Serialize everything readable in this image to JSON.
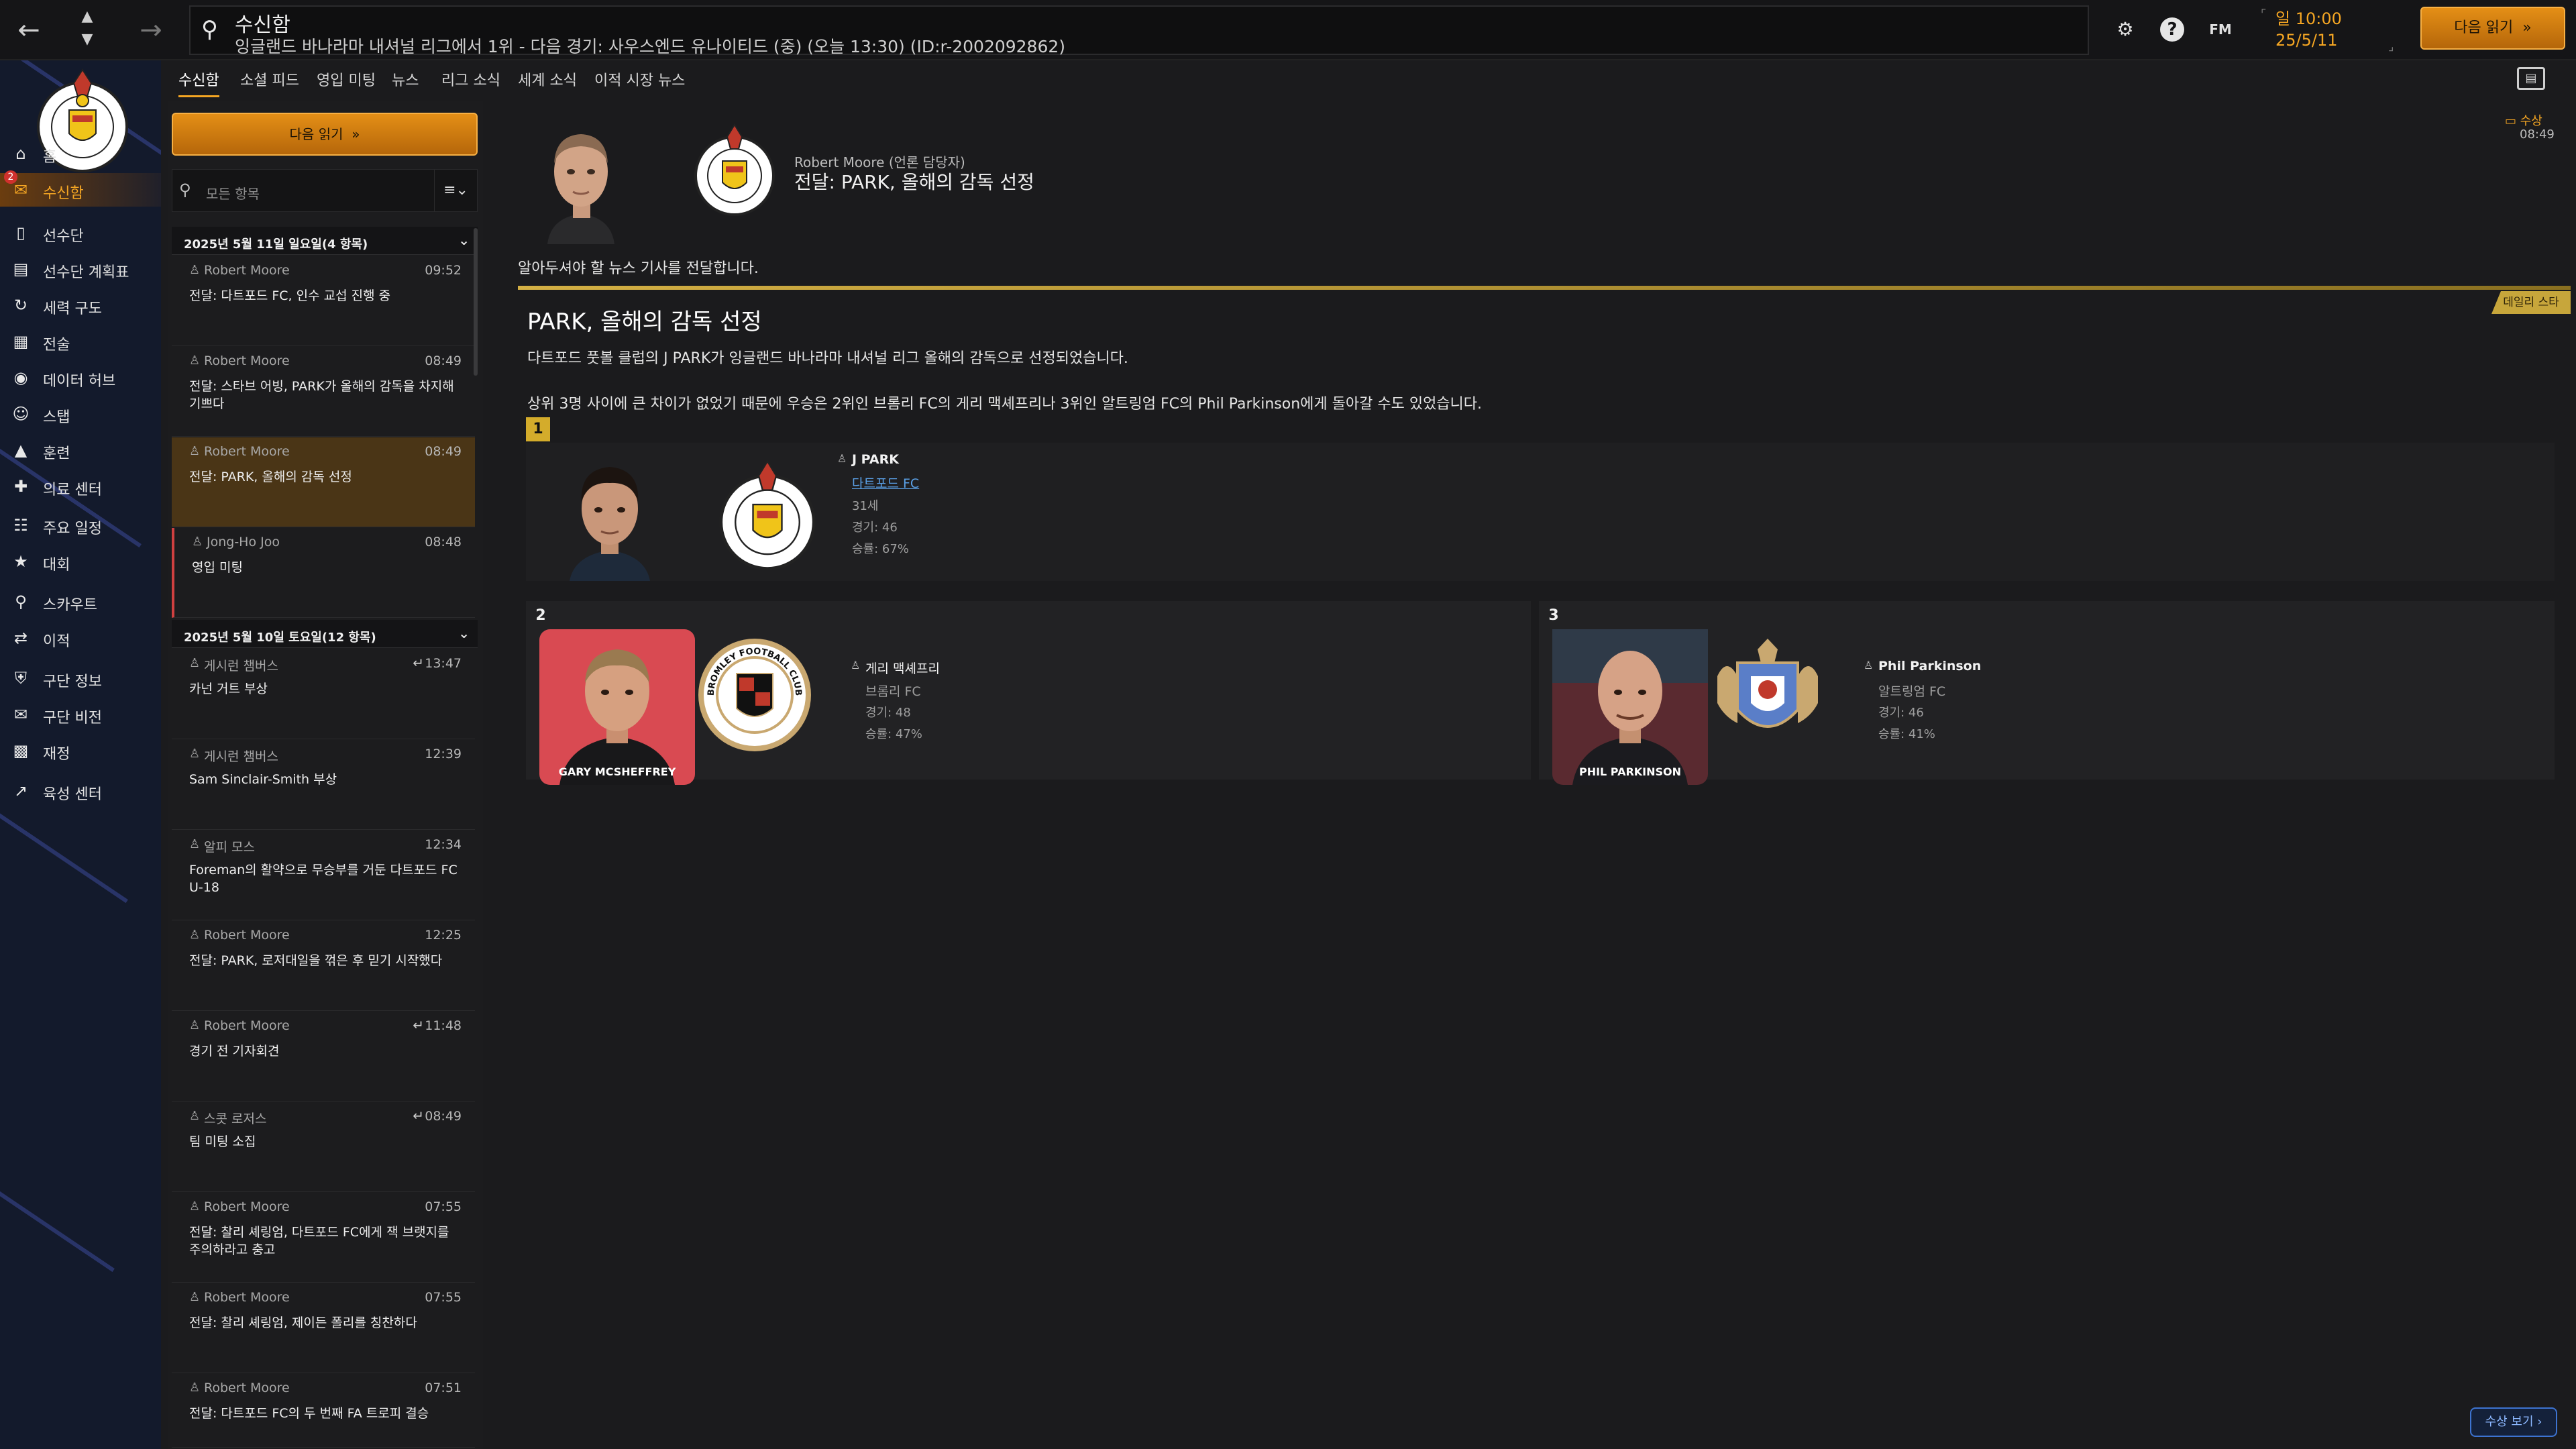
{
  "topbar": {
    "title": "수신함",
    "subtitle": "잉글랜드 바나라마 내셔널 리그에서 1위 - 다음 경기: 사우스엔드 유나이티드 (중) (오늘 13:30) (ID:r-2002092862)",
    "fm": "FM",
    "time": "일 10:00",
    "date": "25/5/11",
    "next_button": "다음 읽기"
  },
  "nav": {
    "items": [
      {
        "label": "홈",
        "icon": "home-icon"
      },
      {
        "label": "수신함",
        "icon": "inbox-icon",
        "badge": "2"
      },
      {
        "label": "선수단",
        "icon": "shirt-icon"
      },
      {
        "label": "선수단 계획표",
        "icon": "clipboard-icon"
      },
      {
        "label": "세력 구도",
        "icon": "dynamics-icon"
      },
      {
        "label": "전술",
        "icon": "tactics-icon"
      },
      {
        "label": "데이터 허브",
        "icon": "data-hub-icon"
      },
      {
        "label": "스탭",
        "icon": "staff-icon"
      },
      {
        "label": "훈련",
        "icon": "training-icon"
      },
      {
        "label": "의료 센터",
        "icon": "medical-icon"
      },
      {
        "label": "주요 일정",
        "icon": "calendar-icon"
      },
      {
        "label": "대회",
        "icon": "trophy-icon"
      },
      {
        "label": "스카우트",
        "icon": "scouting-icon"
      },
      {
        "label": "이적",
        "icon": "transfers-icon"
      },
      {
        "label": "구단 정보",
        "icon": "shield-icon"
      },
      {
        "label": "구단 비전",
        "icon": "vision-icon"
      },
      {
        "label": "재정",
        "icon": "finances-icon"
      },
      {
        "label": "육성 센터",
        "icon": "development-icon"
      }
    ]
  },
  "subtabs": [
    "수신함",
    "소셜 피드",
    "영입 미팅",
    "뉴스",
    "리그 소식",
    "세계 소식",
    "이적 시장 뉴스"
  ],
  "inbox": {
    "next_button": "다음 읽기",
    "search_placeholder": "모든 항목",
    "groups": [
      {
        "header": "2025년 5월 11일 일요일(4 항목)",
        "messages": [
          {
            "sender": "Robert Moore",
            "time": "09:52",
            "subject": "전달: 다트포드 FC, 인수 교섭 진행 중"
          },
          {
            "sender": "Robert Moore",
            "time": "08:49",
            "subject": "전달: 스타브 어빙, PARK가 올해의 감독을 차지해 기쁘다"
          },
          {
            "sender": "Robert Moore",
            "time": "08:49",
            "subject": "전달: PARK, 올해의 감독 선정"
          },
          {
            "sender": "Jong-Ho Joo",
            "time": "08:48",
            "subject": "영입 미팅"
          }
        ]
      },
      {
        "header": "2025년 5월 10일 토요일(12 항목)",
        "messages": [
          {
            "sender": "게시런 챔버스",
            "time": "13:47",
            "subject": "카넌 거트 부상"
          },
          {
            "sender": "게시런 챔버스",
            "time": "12:39",
            "subject": "Sam Sinclair-Smith 부상"
          },
          {
            "sender": "알피 모스",
            "time": "12:34",
            "subject": "Foreman의 활약으로 무승부를 거둔 다트포드 FC U-18"
          },
          {
            "sender": "Robert Moore",
            "time": "12:25",
            "subject": "전달: PARK, 로저대일을 꺾은 후 믿기 시작했다"
          },
          {
            "sender": "Robert Moore",
            "time": "11:48",
            "subject": "경기 전 기자회견"
          },
          {
            "sender": "스콧 로저스",
            "time": "08:49",
            "subject": "팀 미팅 소집"
          },
          {
            "sender": "Robert Moore",
            "time": "07:55",
            "subject": "전달: 찰리 셰링엄, 다트포드 FC에게 잭 브랫지를 주의하라고 충고"
          },
          {
            "sender": "Robert Moore",
            "time": "07:55",
            "subject": "전달: 찰리 셰링엄, 제이든 폴리를 칭찬하다"
          },
          {
            "sender": "Robert Moore",
            "time": "07:51",
            "subject": "전달: 다트포드 FC의 두 번째 FA 트로피 결승"
          }
        ]
      }
    ]
  },
  "message": {
    "from": "Robert Moore (언론 담당자)",
    "subject": "전달: PARK, 올해의 감독 선정",
    "award_tag": "수상",
    "time": "08:49",
    "intro": "알아두셔야 할 뉴스 기사를 전달합니다.",
    "article": {
      "tag": "데일리 스타",
      "title": "PARK, 올해의 감독 선정",
      "p1": "다트포드 풋볼 클럽의 J PARK가 잉글랜드 바나라마 내셔널 리그 올해의 감독으로 선정되었습니다.",
      "p2": "상위 3명 사이에 큰 차이가 없었기 때문에 우승은 2위인 브롬리 FC의 게리 맥셰프리나 3위인 알트링엄 FC의 Phil Parkinson에게 돌아갈 수도 있었습니다.",
      "candidates": [
        {
          "rank": "1",
          "name": "J PARK",
          "club": "다트포드 FC",
          "age": "31세",
          "games": "경기: 46",
          "winrate": "승률: 67%"
        },
        {
          "rank": "2",
          "name": "게리 맥셰프리",
          "club": "브롬리 FC",
          "games": "경기: 48",
          "winrate": "승률: 47%",
          "photo_caption": "GARY MCSHEFFREY",
          "crest_text": "BROMLEY FOOTBALL CLUB"
        },
        {
          "rank": "3",
          "name": "Phil Parkinson",
          "club": "알트링엄 FC",
          "games": "경기: 46",
          "winrate": "승률: 41%",
          "photo_caption": "PHIL PARKINSON"
        }
      ]
    },
    "awards_button": "수상 보기"
  },
  "colors": {
    "accent": "#f5a623",
    "gold": "#d4ac2b",
    "link": "#5aa0e6",
    "nav_bg": "#131a2c"
  }
}
